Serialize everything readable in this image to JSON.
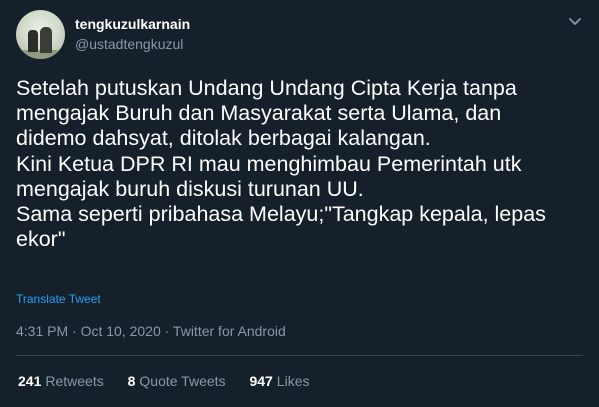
{
  "user": {
    "display_name": "tengkuzulkarnain",
    "handle": "@ustadtengkuzul"
  },
  "tweet": {
    "text": "Setelah putuskan Undang Undang Cipta Kerja tanpa\nmengajak Buruh dan Masyarakat serta Ulama, dan\ndidemo dahsyat, ditolak berbagai kalangan.\nKini Ketua DPR RI mau menghimbau Pemerintah utk\nmengajak buruh diskusi turunan UU.\nSama seperti pribahasa Melayu;\"Tangkap kepala, lepas\nekor\"",
    "translate_label": "Translate Tweet",
    "timestamp": "4:31 PM · Oct 10, 2020 · Twitter for Android"
  },
  "stats": {
    "retweets_count": "241",
    "retweets_label": "Retweets",
    "quotes_count": "8",
    "quotes_label": "Quote Tweets",
    "likes_count": "947",
    "likes_label": "Likes"
  },
  "icons": {
    "menu": "chevron-down-icon",
    "avatar": "avatar"
  },
  "colors": {
    "background": "#15202b",
    "text": "#ffffff",
    "muted": "#8899a6",
    "accent": "#1da1f2",
    "divider": "#38444d"
  }
}
